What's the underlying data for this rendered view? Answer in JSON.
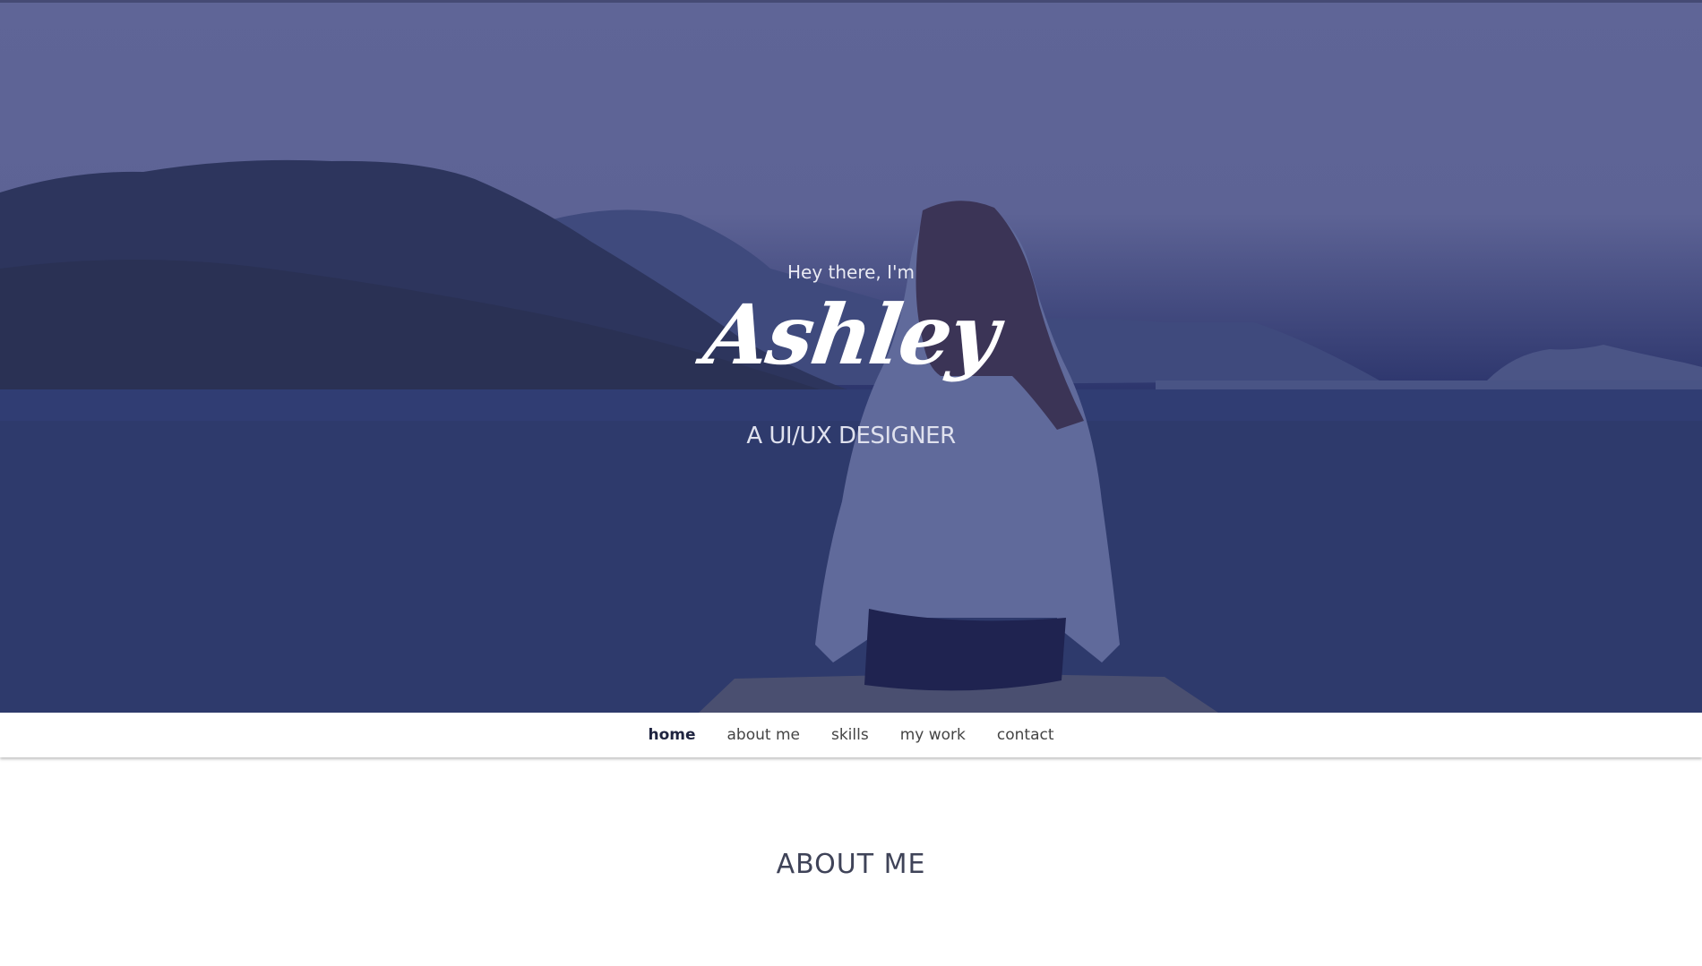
{
  "hero": {
    "greeting": "Hey there, I'm",
    "name": "Ashley",
    "role": "A UI/UX DESIGNER",
    "overlay_color": "#2f3a78"
  },
  "nav": {
    "items": [
      {
        "label": "home",
        "active": true
      },
      {
        "label": "about me",
        "active": false
      },
      {
        "label": "skills",
        "active": false
      },
      {
        "label": "my work",
        "active": false
      },
      {
        "label": "contact",
        "active": false
      }
    ]
  },
  "about": {
    "title": "ABOUT ME"
  }
}
